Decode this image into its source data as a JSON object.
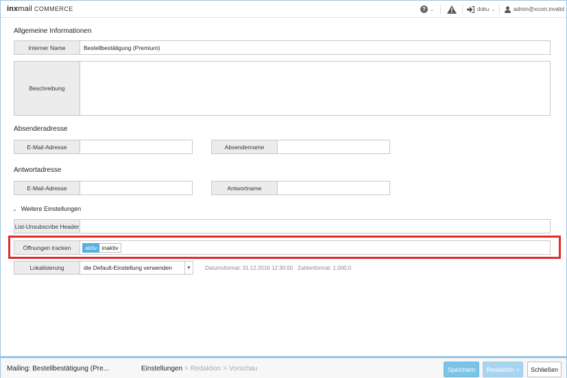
{
  "topbar": {
    "logo_bold": "inx",
    "logo_mail": "mail",
    "logo_suffix": "COMMERCE",
    "help_icon": "?",
    "warning_icon": "warning-icon",
    "login_label": "doku",
    "user_label": "admin@xcom.invalid"
  },
  "general": {
    "title": "Allgemeine Informationen",
    "internal_name_label": "Interner Name",
    "internal_name_value": "Bestellbestätigung (Premium)",
    "description_label": "Beschreibung",
    "description_value": ""
  },
  "sender": {
    "title": "Absenderadresse",
    "email_label": "E-Mail-Adresse",
    "email_value": "",
    "name_label": "Absendername",
    "name_value": ""
  },
  "reply": {
    "title": "Antwortadresse",
    "email_label": "E-Mail-Adresse",
    "email_value": "",
    "name_label": "Antwortname",
    "name_value": ""
  },
  "more": {
    "title": "Weitere Einstellungen",
    "unsubscribe_label": "List-Unsubscribe Header",
    "unsubscribe_value": "",
    "tracking_label": "Öffnungen tracken",
    "tracking_on": "aktiv",
    "tracking_off": "inaktiv",
    "tracking_selected": "aktiv",
    "locale_label": "Lokalisierung",
    "locale_value": "die Default-Einstellung verwenden",
    "date_format": "Datumsformat: 31.12.2016 12:30:00",
    "number_format": "Zahlenformat: 1.000,0"
  },
  "footer": {
    "mailing": "Mailing: Bestellbestätigung (Pre...",
    "step_current": "Einstellungen",
    "step_rest": " > Redaktion > Vorschau",
    "save": "Speichern",
    "next": "Redaktion >",
    "close": "Schließen"
  },
  "colors": {
    "accent": "#5aaedc",
    "highlight": "#e02b2b",
    "frame": "#9bc4e2"
  }
}
